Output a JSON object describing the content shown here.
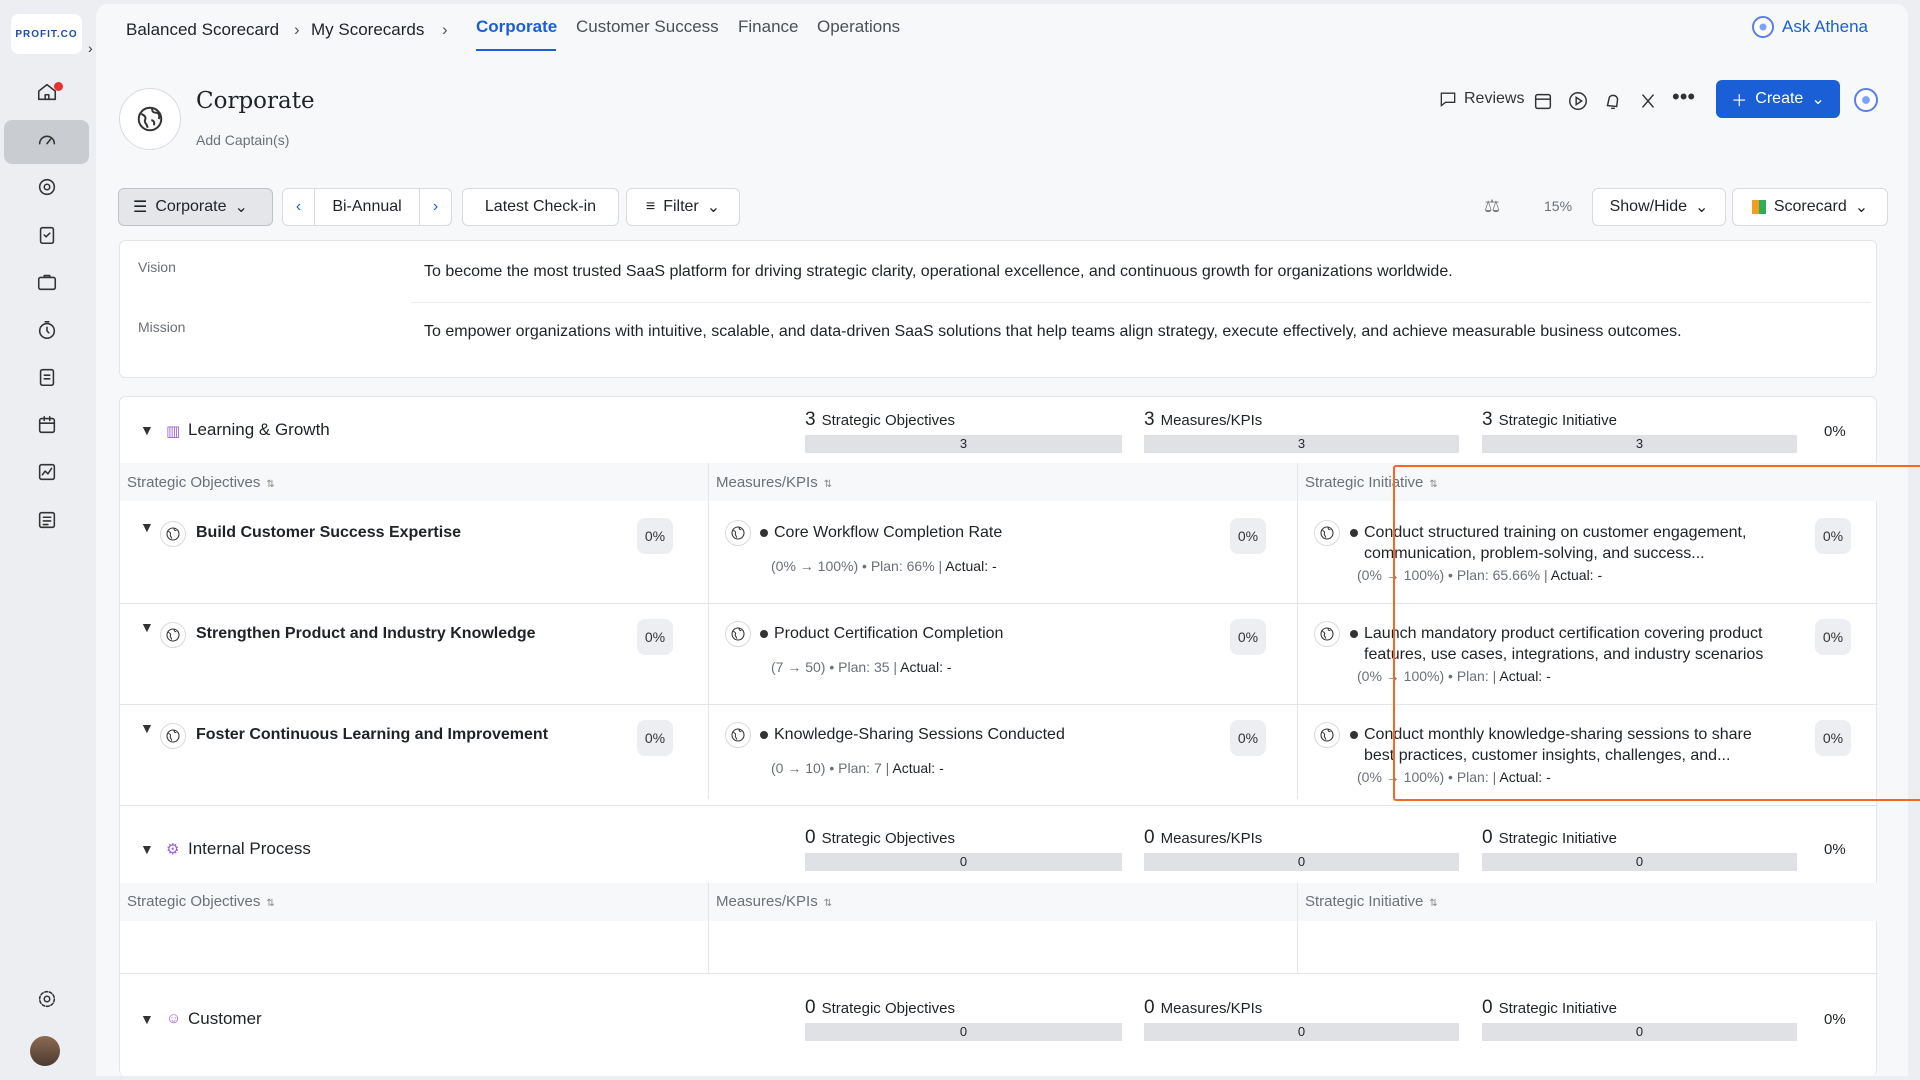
{
  "app": {
    "logo": "PROFIT.CO"
  },
  "breadcrumb": [
    "Balanced Scorecard",
    "My Scorecards"
  ],
  "tabs": [
    "Corporate",
    "Customer Success",
    "Finance",
    "Operations"
  ],
  "ask": "Ask Athena",
  "header": {
    "title": "Corporate",
    "sub": "Add Captain(s)",
    "reviews": "Reviews",
    "create": "Create"
  },
  "filters": {
    "corporate": "Corporate",
    "period": "Bi-Annual",
    "checkin": "Latest Check-in",
    "filter": "Filter",
    "weight": "15%",
    "showhide": "Show/Hide",
    "view": "Scorecard"
  },
  "vision": {
    "label": "Vision",
    "text": "To become the most trusted SaaS platform for driving strategic clarity, operational excellence, and continuous growth for organizations worldwide."
  },
  "mission": {
    "label": "Mission",
    "text": "To empower organizations with intuitive, scalable, and data-driven SaaS solutions that help teams align strategy, execute effectively, and achieve measurable business outcomes."
  },
  "labels": {
    "so": "Strategic Objectives",
    "kpi": "Measures/KPIs",
    "si": "Strategic Initiative"
  },
  "perspectives": [
    {
      "name": "Learning & Growth",
      "so": "3",
      "kpi": "3",
      "si": "3",
      "pct": "0%"
    },
    {
      "name": "Internal Process",
      "so": "0",
      "kpi": "0",
      "si": "0",
      "pct": "0%"
    },
    {
      "name": "Customer",
      "so": "0",
      "kpi": "0",
      "si": "0",
      "pct": "0%"
    }
  ],
  "rows": [
    {
      "obj": "Build Customer Success Expertise",
      "obj_pct": "0%",
      "kpi": "Core Workflow Completion Rate",
      "kpi_pct": "0%",
      "kpi_range": "(0% → 100%) • Plan: 66% | ",
      "kpi_actual": "Actual: -",
      "init1": "Conduct structured training on customer engagement,",
      "init2": "communication, problem-solving, and success...",
      "init_pct": "0%",
      "init_range": "(0% → 100%) • Plan: 65.66% | ",
      "init_actual": "Actual: -"
    },
    {
      "obj": "Strengthen Product and Industry Knowledge",
      "obj_pct": "0%",
      "kpi": "Product Certification Completion",
      "kpi_pct": "0%",
      "kpi_range": "(7 → 50) • Plan: 35 | ",
      "kpi_actual": "Actual: -",
      "init1": "Launch mandatory product certification covering product",
      "init2": "features, use cases, integrations, and industry scenarios",
      "init_pct": "0%",
      "init_range": "(0% → 100%) • Plan:  | ",
      "init_actual": "Actual: -"
    },
    {
      "obj": "Foster Continuous Learning and Improvement",
      "obj_pct": "0%",
      "kpi": "Knowledge-Sharing Sessions Conducted",
      "kpi_pct": "0%",
      "kpi_range": "(0 → 10) • Plan: 7 | ",
      "kpi_actual": "Actual: -",
      "init1": "Conduct monthly knowledge-sharing sessions to share",
      "init2": "best practices, customer insights, challenges, and...",
      "init_pct": "0%",
      "init_range": "(0% → 100%) • Plan:  | ",
      "init_actual": "Actual: -"
    }
  ]
}
